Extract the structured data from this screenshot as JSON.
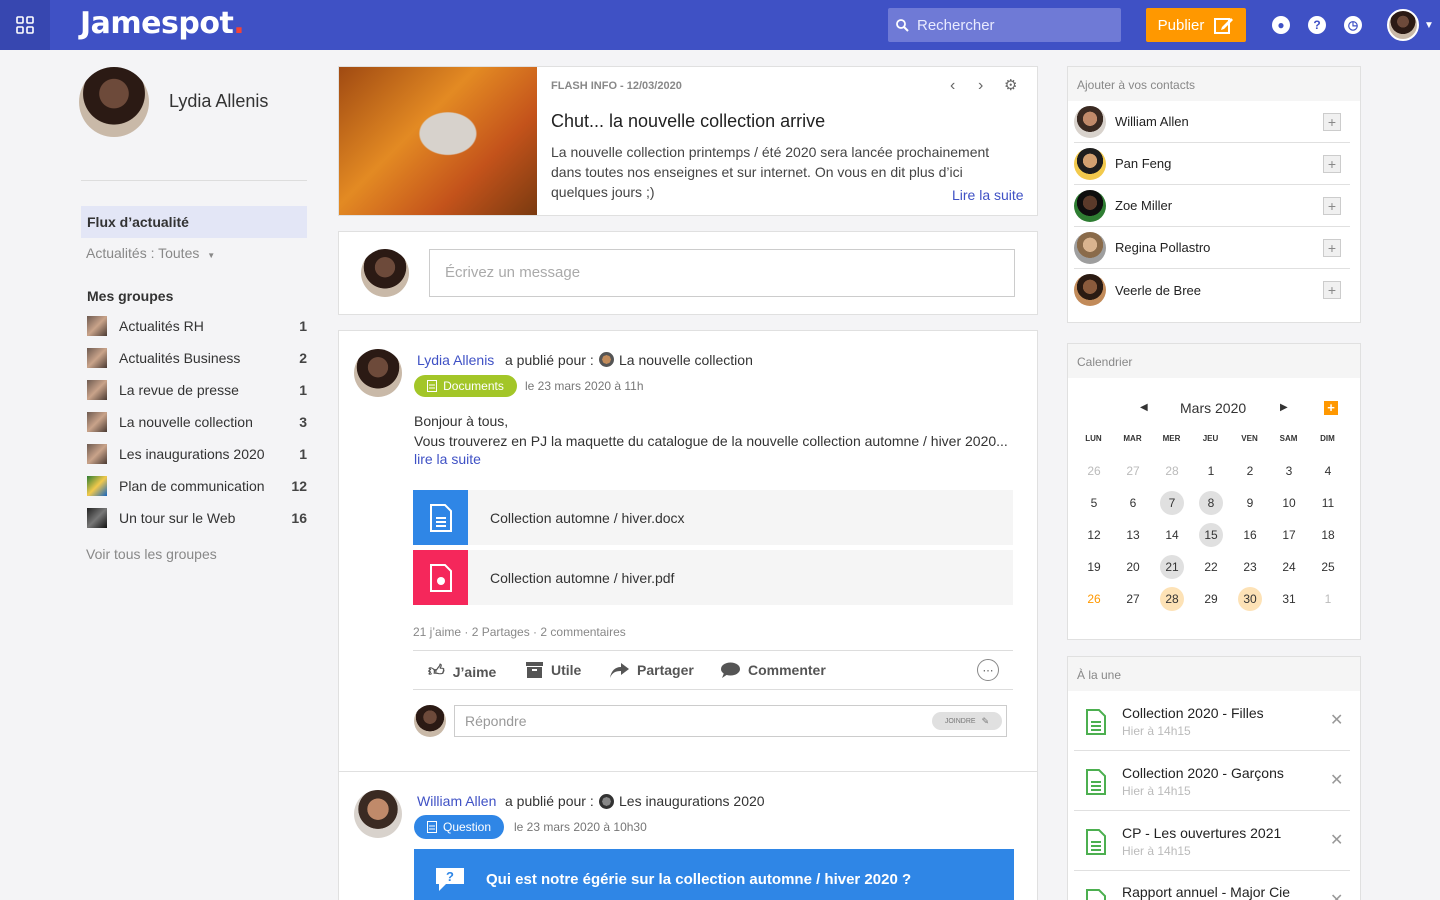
{
  "topbar": {
    "logo": "Jamespot",
    "logo_dot": ".",
    "search_placeholder": "Rechercher",
    "publish_label": "Publier"
  },
  "profile": {
    "name": "Lydia Allenis"
  },
  "nav": {
    "feed_label": "Flux d’actualité",
    "filter_label": "Actualités : Toutes",
    "groups_title": "Mes groupes",
    "groups": [
      {
        "name": "Actualités RH",
        "count": "1"
      },
      {
        "name": "Actualités Business",
        "count": "2"
      },
      {
        "name": "La revue de presse",
        "count": "1"
      },
      {
        "name": "La nouvelle collection",
        "count": "3"
      },
      {
        "name": "Les inaugurations 2020",
        "count": "1"
      },
      {
        "name": "Plan de communication",
        "count": "12"
      },
      {
        "name": "Un tour sur le Web",
        "count": "16"
      }
    ],
    "see_all": "Voir tous les groupes"
  },
  "flash": {
    "meta": "FLASH INFO - 12/03/2020",
    "title": "Chut... la nouvelle collection arrive",
    "text": "La nouvelle collection printemps / été 2020 sera lancée prochainement dans toutes nos enseignes et sur internet. On vous en dit plus d’ici quelques jours ;)",
    "read_more": "Lire la suite"
  },
  "composer": {
    "placeholder": "Écrivez un message"
  },
  "post1": {
    "author": "Lydia Allenis",
    "published_for": "a publié pour :",
    "group": "La nouvelle collection",
    "tag": "Documents",
    "date": "le 23 mars 2020 à 11h",
    "body_line1": "Bonjour à tous,",
    "body_line2": "Vous trouverez en PJ la maquette du catalogue de la nouvelle collection automne / hiver 2020...",
    "read_more": "lire la suite",
    "attachments": [
      {
        "name": "Collection automne / hiver.docx",
        "color": "#2f86e6"
      },
      {
        "name": "Collection automne / hiver.pdf",
        "color": "#f5275b"
      }
    ],
    "stats": "21 j’aime · 2 Partages · 2 commentaires",
    "actions": {
      "like": "J’aime",
      "useful": "Utile",
      "share": "Partager",
      "comment": "Commenter"
    },
    "reply_placeholder": "Répondre",
    "attach_label": "JOINDRE"
  },
  "post2": {
    "author": "William Allen",
    "published_for": "a publié pour :",
    "group": "Les inaugurations 2020",
    "tag": "Question",
    "date": "le 23 mars 2020 à 10h30",
    "question": "Qui est notre égérie sur la collection automne / hiver 2020 ?"
  },
  "contacts": {
    "title": "Ajouter à vos contacts",
    "items": [
      {
        "name": "William Allen"
      },
      {
        "name": "Pan Feng"
      },
      {
        "name": "Zoe Miller"
      },
      {
        "name": "Regina Pollastro"
      },
      {
        "name": "Veerle de Bree"
      }
    ]
  },
  "calendar": {
    "title": "Calendrier",
    "month": "Mars 2020",
    "days_of_week": [
      "LUN",
      "MAR",
      "MER",
      "JEU",
      "VEN",
      "SAM",
      "DIM"
    ],
    "weeks": [
      [
        {
          "d": "26",
          "o": 1
        },
        {
          "d": "27",
          "o": 1
        },
        {
          "d": "28",
          "o": 1
        },
        {
          "d": "1"
        },
        {
          "d": "2"
        },
        {
          "d": "3"
        },
        {
          "d": "4"
        }
      ],
      [
        {
          "d": "5"
        },
        {
          "d": "6"
        },
        {
          "d": "7",
          "e": 1
        },
        {
          "d": "8",
          "e": 1
        },
        {
          "d": "9"
        },
        {
          "d": "10"
        },
        {
          "d": "11"
        }
      ],
      [
        {
          "d": "12"
        },
        {
          "d": "13"
        },
        {
          "d": "14"
        },
        {
          "d": "15",
          "e": 1
        },
        {
          "d": "16"
        },
        {
          "d": "17"
        },
        {
          "d": "18"
        }
      ],
      [
        {
          "d": "19"
        },
        {
          "d": "20"
        },
        {
          "d": "21",
          "e": 1
        },
        {
          "d": "22"
        },
        {
          "d": "23"
        },
        {
          "d": "24"
        },
        {
          "d": "25"
        }
      ],
      [
        {
          "d": "26",
          "t": 1
        },
        {
          "d": "27"
        },
        {
          "d": "28",
          "h": 1
        },
        {
          "d": "29"
        },
        {
          "d": "30",
          "h": 1
        },
        {
          "d": "31"
        },
        {
          "d": "1",
          "o": 1
        }
      ]
    ]
  },
  "featured": {
    "title": "À la une",
    "items": [
      {
        "title": "Collection 2020 - Filles",
        "time": "Hier à 14h15"
      },
      {
        "title": "Collection 2020 - Garçons",
        "time": "Hier à 14h15"
      },
      {
        "title": "CP - Les ouvertures 2021",
        "time": "Hier à 14h15"
      },
      {
        "title": "Rapport annuel - Major Cie",
        "time": ""
      }
    ]
  },
  "colors": {
    "brand": "#3f51c5",
    "publish": "#ff9800",
    "documents_tag": "#a3c628",
    "question_tag": "#2f86e6",
    "featured_icon": "#4caf50"
  },
  "icons": [
    "apps-grid-icon",
    "search-icon",
    "edit-icon",
    "bell-icon",
    "help-icon",
    "clock-icon",
    "settings-icon",
    "thumb-up-icon",
    "archive-icon",
    "share-icon",
    "comment-icon",
    "document-icon",
    "pdf-icon",
    "paperclip-icon",
    "plus-icon",
    "close-icon",
    "question-icon"
  ]
}
